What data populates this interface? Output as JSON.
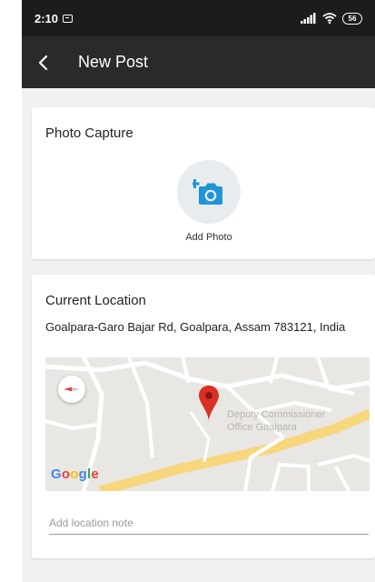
{
  "status_bar": {
    "time": "2:10",
    "battery": "56"
  },
  "app_bar": {
    "title": "New Post"
  },
  "photo_card": {
    "title": "Photo Capture",
    "button_label": "Add Photo",
    "icon": "add-photo-icon",
    "accent_color": "#1f95d8"
  },
  "location_card": {
    "title": "Current Location",
    "address": "Goalpara-Garo Bajar Rd, Goalpara, Assam 783121, India",
    "map": {
      "poi_label_line1": "Deputy Commissioner",
      "poi_label_line2": "Office Goalpara",
      "logo_letters": [
        "G",
        "o",
        "o",
        "g",
        "l",
        "e"
      ],
      "logo_colors": [
        "#4285F4",
        "#EA4335",
        "#FBBC05",
        "#4285F4",
        "#34A853",
        "#EA4335"
      ],
      "pin_color": "#d93025"
    },
    "note_placeholder": "Add location note"
  }
}
